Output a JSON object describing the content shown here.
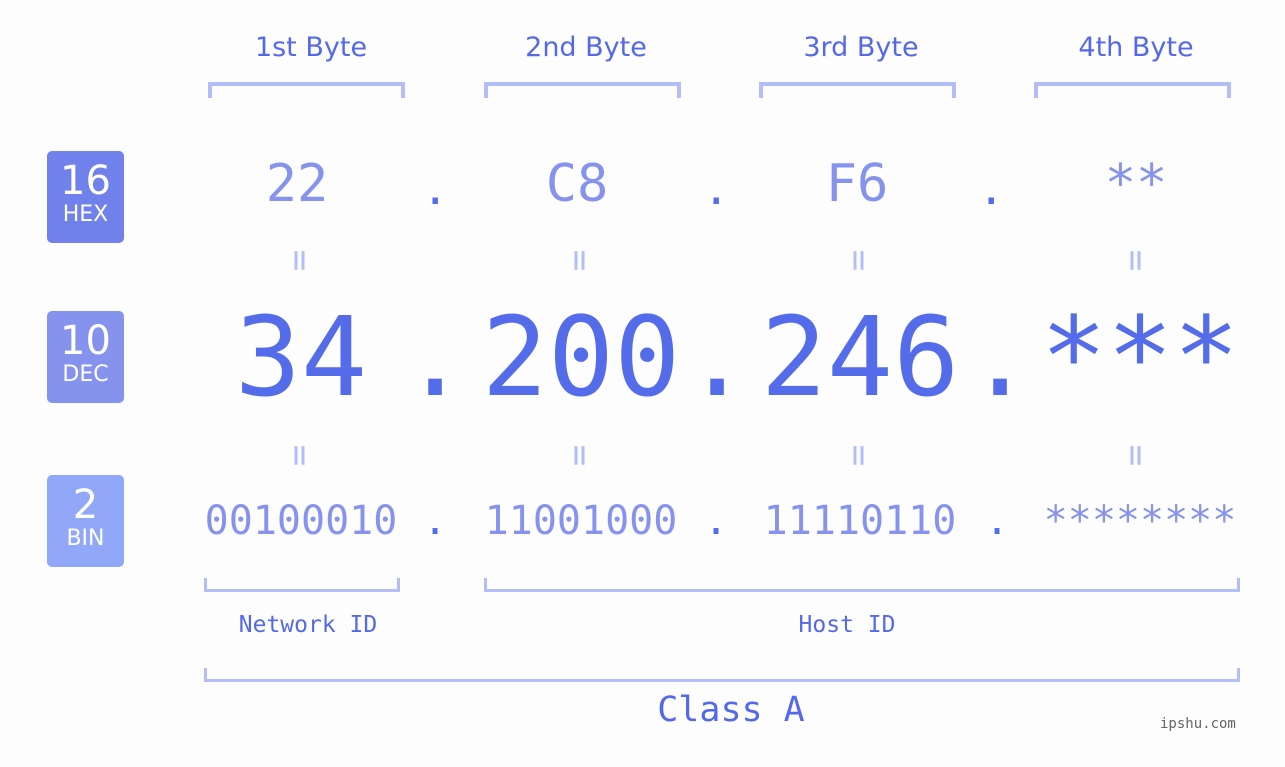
{
  "bytes": {
    "labels": [
      "1st Byte",
      "2nd Byte",
      "3rd Byte",
      "4th Byte"
    ]
  },
  "bases": [
    {
      "num": "16",
      "name": "HEX",
      "color": "#7181ec"
    },
    {
      "num": "10",
      "name": "DEC",
      "color": "#8593ee"
    },
    {
      "num": "2",
      "name": "BIN",
      "color": "#91a7f8"
    }
  ],
  "hex": [
    "22",
    "C8",
    "F6",
    "**"
  ],
  "dec": [
    "34",
    "200",
    "246",
    "***"
  ],
  "bin": [
    "00100010",
    "11001000",
    "11110110",
    "********"
  ],
  "separator": ".",
  "equals": "=",
  "network_id_label": "Network ID",
  "host_id_label": "Host ID",
  "class_label": "Class A",
  "watermark": "ipshu.com"
}
